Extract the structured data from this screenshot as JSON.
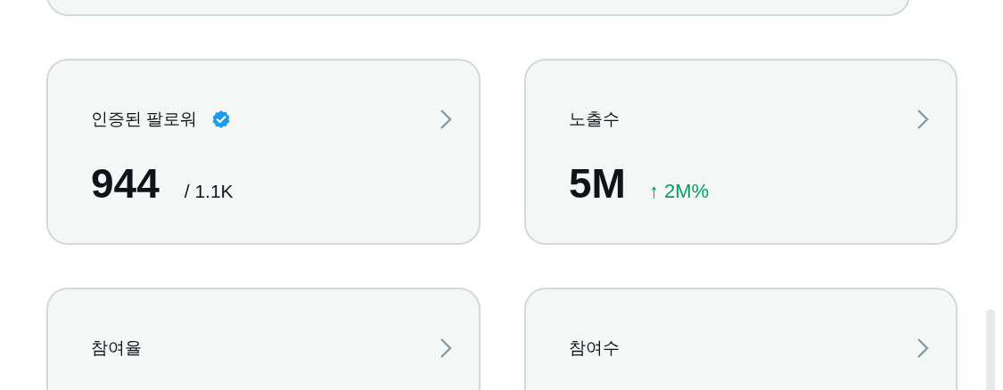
{
  "cards": [
    {
      "label": "인증된 팔로워",
      "verified": true,
      "value": "944",
      "detail": {
        "kind": "total",
        "text": "/ 1.1K"
      }
    },
    {
      "label": "노출수",
      "verified": false,
      "value": "5M",
      "detail": {
        "kind": "change",
        "text": "↑ 2M%"
      }
    },
    {
      "label": "참여율",
      "verified": false
    },
    {
      "label": "참여수",
      "verified": false
    }
  ]
}
